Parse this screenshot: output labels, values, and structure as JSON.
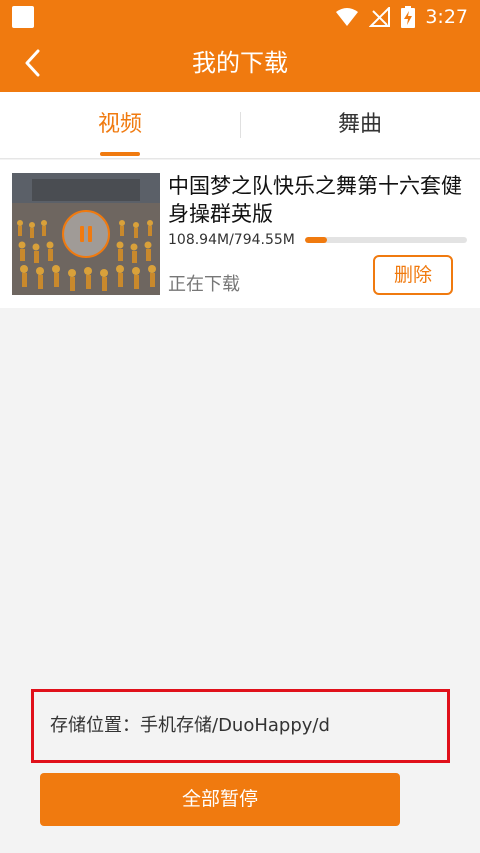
{
  "status_bar": {
    "time": "3:27",
    "icons": [
      "notification-square-icon",
      "wifi-icon",
      "no-signal-icon",
      "battery-charging-icon"
    ]
  },
  "app_bar": {
    "title": "我的下载",
    "back_icon": "chevron-left-icon"
  },
  "tabs": [
    {
      "label": "视频",
      "active": true
    },
    {
      "label": "舞曲",
      "active": false
    }
  ],
  "downloads": [
    {
      "title": "中国梦之队快乐之舞第十六套健身操群英版",
      "size": "108.94M/794.55M",
      "progress": 0.137,
      "status": "正在下载",
      "delete_label": "删除"
    }
  ],
  "storage": {
    "text": "存储位置：手机存储/DuoHappy/d"
  },
  "pause_all_label": "全部暂停",
  "colors": {
    "accent": "#f07a0f",
    "highlight_box": "#e0101a",
    "background": "#f3f3f3"
  }
}
